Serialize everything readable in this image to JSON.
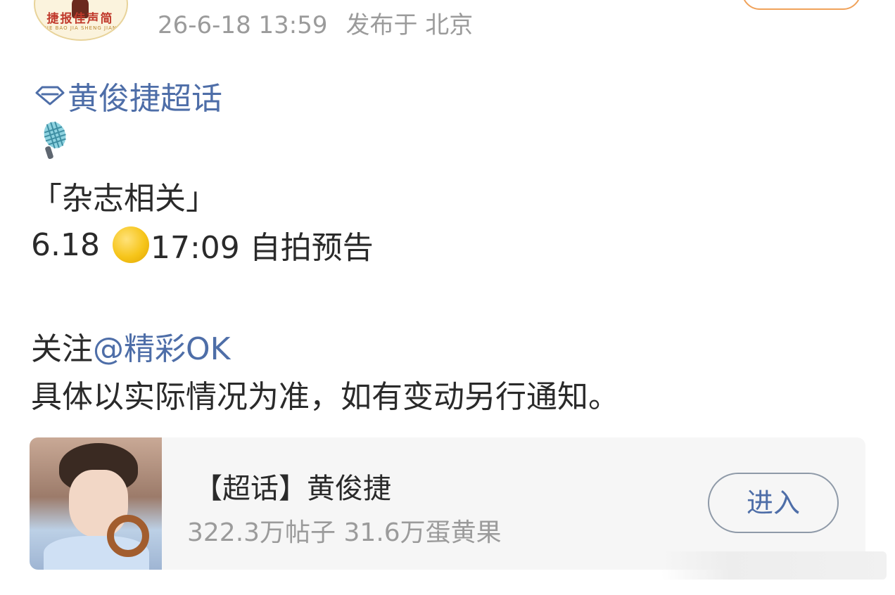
{
  "header": {
    "avatar_text": "捷报佳声简",
    "avatar_subtext": "JIE BAO JIA SHENG JIAN",
    "timestamp": "26-6-18 13:59",
    "location": "发布于 北京"
  },
  "post": {
    "topic_label": "黄俊捷超话",
    "line_category": "「杂志相关」",
    "line_date": "6.18",
    "line_time_text": "17:09 自拍预告",
    "line_follow_prefix": "关注",
    "line_follow_mention": "@精彩OK",
    "line_notice": "具体以实际情况为准，如有变动另行通知。"
  },
  "card": {
    "title": "【超话】黄俊捷",
    "stats": "322.3万帖子 31.6万蛋黄果",
    "enter_label": "进入"
  },
  "colors": {
    "link": "#4e6ea8",
    "meta_gray": "#9b9b9b",
    "text": "#2a2a2a",
    "card_bg": "#f6f6f6",
    "follow_border": "#f0a25a"
  },
  "icons": [
    "diamond-icon",
    "microphone-icon",
    "yellow-circle-emoji"
  ]
}
